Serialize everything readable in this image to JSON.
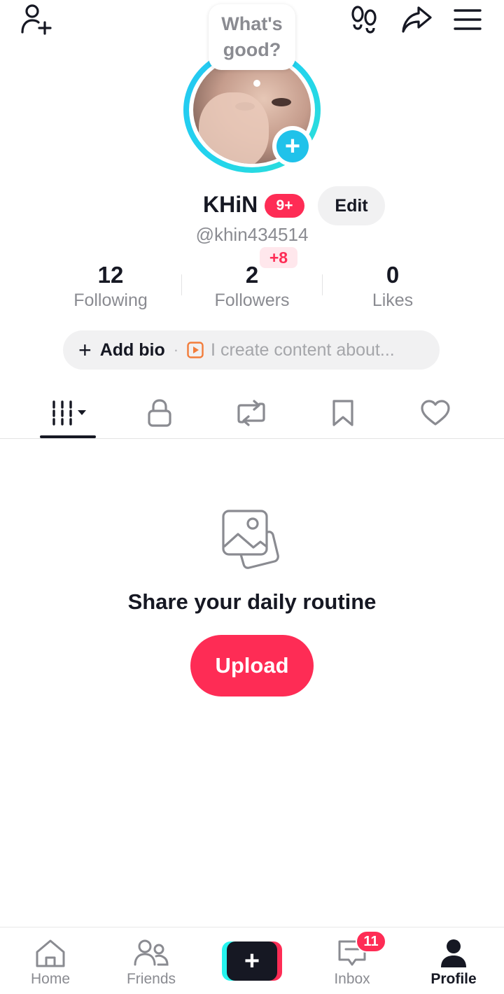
{
  "avatar": {
    "bubble_text": "What's good?"
  },
  "profile": {
    "name": "KHiN",
    "name_badge": "9+",
    "edit_label": "Edit",
    "handle": "@khin434514"
  },
  "stats": [
    {
      "value": "12",
      "label": "Following"
    },
    {
      "value": "2",
      "label": "Followers",
      "badge": "+8"
    },
    {
      "value": "0",
      "label": "Likes"
    }
  ],
  "bio": {
    "add_label": "Add bio",
    "separator": "·",
    "placeholder": "I create content about..."
  },
  "tabs": [
    {
      "icon": "videos-grid-icon",
      "selected": true
    },
    {
      "icon": "lock-icon"
    },
    {
      "icon": "repost-icon"
    },
    {
      "icon": "bookmark-icon"
    },
    {
      "icon": "heart-icon"
    }
  ],
  "empty_state": {
    "title": "Share your daily routine",
    "button": "Upload"
  },
  "nav": {
    "items": [
      {
        "label": "Home",
        "icon": "home-icon"
      },
      {
        "label": "Friends",
        "icon": "friends-icon"
      },
      {
        "label": "",
        "icon": "create-plus-icon"
      },
      {
        "label": "Inbox",
        "icon": "inbox-icon",
        "badge": "11"
      },
      {
        "label": "Profile",
        "icon": "profile-icon",
        "active": true
      }
    ]
  },
  "colors": {
    "accent": "#fe2c55",
    "ring": "#22d3ee",
    "text": "#161823",
    "muted": "#8a8b91"
  }
}
